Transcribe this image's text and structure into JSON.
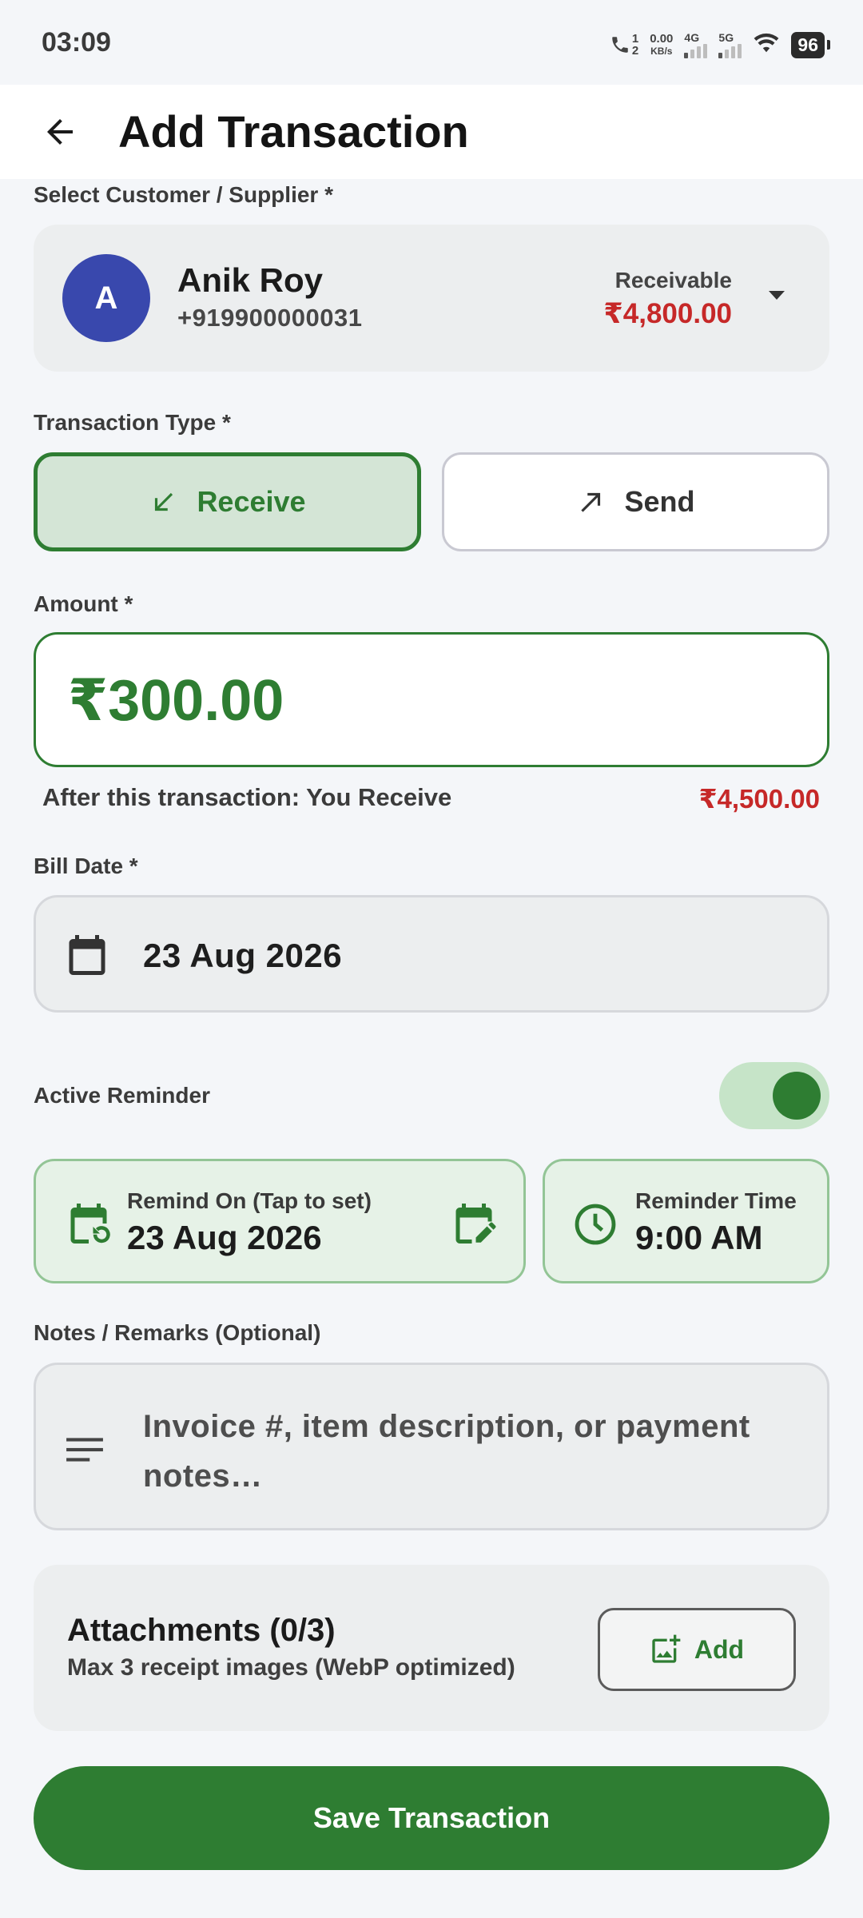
{
  "status_bar": {
    "time": "03:09",
    "call_sim": [
      "1",
      "2"
    ],
    "speed_value": "0.00",
    "speed_unit": "KB/s",
    "net1": "4G",
    "net2": "5G",
    "battery": "96"
  },
  "header": {
    "title": "Add Transaction",
    "back_icon": "arrow-left-icon"
  },
  "customer": {
    "section_label": "Select Customer / Supplier *",
    "avatar_letter": "A",
    "avatar_color": "#3948ad",
    "name": "Anik Roy",
    "phone": "+919900000031",
    "balance_label": "Receivable",
    "balance_value": "₹4,800.00"
  },
  "transaction_type": {
    "label": "Transaction Type *",
    "receive_label": "Receive",
    "send_label": "Send",
    "selected": "Receive"
  },
  "amount": {
    "label": "Amount *",
    "value": "₹300.00",
    "after_text": "After this transaction: You Receive",
    "after_value": "₹4,500.00"
  },
  "bill_date": {
    "label": "Bill Date *",
    "value": "23 Aug 2026"
  },
  "reminder": {
    "label": "Active Reminder",
    "enabled": true,
    "remind_on_label": "Remind On (Tap to set)",
    "remind_on_value": "23 Aug 2026",
    "time_label": "Reminder Time",
    "time_value": "9:00 AM"
  },
  "notes": {
    "label": "Notes / Remarks (Optional)",
    "placeholder": "Invoice #, item description, or payment notes…"
  },
  "attachments": {
    "title": "Attachments (0/3)",
    "subtitle": "Max 3 receipt images (WebP optimized)",
    "add_label": "Add"
  },
  "save_label": "Save Transaction",
  "colors": {
    "primary": "#2e7d32",
    "negative": "#c62828",
    "background": "#f4f6f9"
  }
}
